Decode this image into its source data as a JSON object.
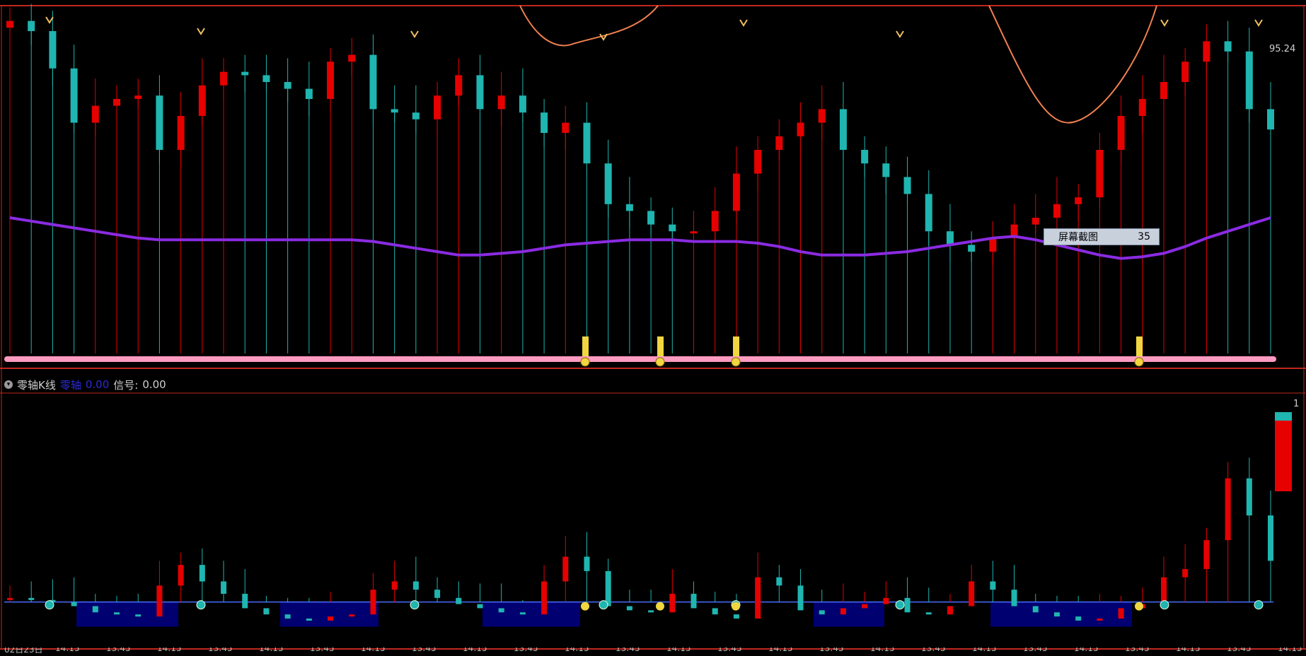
{
  "indicator": {
    "name": "零轴K线",
    "zero_label": "零轴",
    "zero_value": "0.00",
    "signal_label": "信号:",
    "signal_value": "0.00"
  },
  "tooltip": {
    "label": "屏幕截图",
    "value": "35"
  },
  "price_readout": "95.24",
  "right_scale_top": "1",
  "x_axis": {
    "date_label": "02日23日",
    "tick_labels": [
      "14:15",
      "13:45",
      "14:15",
      "13:45",
      "14:15",
      "13:45",
      "14:15",
      "13:45",
      "14:15",
      "13:45",
      "14:15",
      "13:45",
      "14:15",
      "13:45",
      "14:15",
      "13:45",
      "14:15",
      "13:45",
      "14:15",
      "13:45",
      "14:15",
      "13:45",
      "14:15",
      "13:45",
      "14:15"
    ]
  },
  "colors": {
    "up": "#e60000",
    "down": "#1fb5b0",
    "ma": "#8a2be2",
    "border": "#c0281e",
    "zero_fill": "#000070",
    "zero_line": "#4a6cff",
    "bottom_band": "#ff9ac0",
    "signal_coin": "#f0d640",
    "orange_curve": "#f08050"
  },
  "chart_data": [
    {
      "type": "candlestick",
      "title": "",
      "xlabel": "",
      "ylabel": "",
      "ylim": [
        0,
        100
      ],
      "grid": false,
      "ma": [
        40,
        39,
        38,
        37,
        36,
        35,
        34,
        33.5,
        33.5,
        33.5,
        33.5,
        33.5,
        33.5,
        33.5,
        33.5,
        33.5,
        33.5,
        33,
        32,
        31,
        30,
        29,
        29,
        29.5,
        30,
        31,
        32,
        32.5,
        33,
        33.5,
        33.5,
        33.5,
        33,
        33,
        33,
        32.5,
        31.5,
        30,
        29,
        29,
        29,
        29.5,
        30,
        31,
        32,
        33,
        34,
        34.5,
        33.5,
        32,
        30.5,
        29,
        28,
        28.5,
        29.5,
        31.5,
        34,
        36,
        38,
        40
      ],
      "closes": [
        98,
        95,
        84,
        68,
        73,
        75,
        76,
        60,
        70,
        79,
        83,
        82,
        80,
        78,
        75,
        86,
        88,
        72,
        71,
        69,
        76,
        82,
        72,
        76,
        71,
        65,
        68,
        56,
        44,
        42,
        38,
        36,
        36,
        42,
        53,
        60,
        64,
        68,
        72,
        60,
        56,
        52,
        47,
        36,
        32,
        30,
        34,
        38,
        40,
        44,
        46,
        60,
        70,
        75,
        80,
        86,
        92,
        89,
        72,
        66
      ]
    },
    {
      "type": "candlestick",
      "title": "",
      "xlabel": "",
      "ylabel": "",
      "ylim": [
        -20,
        100
      ],
      "grid": false,
      "closes": [
        2,
        1,
        0,
        -2,
        -5,
        -6,
        -7,
        8,
        18,
        10,
        4,
        -3,
        -6,
        -8,
        -9,
        -7,
        -6,
        6,
        10,
        6,
        2,
        -1,
        -3,
        -5,
        -6,
        10,
        22,
        15,
        -2,
        -4,
        -5,
        4,
        -3,
        -6,
        -8,
        12,
        8,
        -4,
        -6,
        -3,
        -1,
        2,
        -5,
        -6,
        -2,
        10,
        6,
        -2,
        -5,
        -7,
        -9,
        -8,
        -3,
        -1,
        12,
        16,
        30,
        60,
        42,
        20
      ]
    }
  ]
}
